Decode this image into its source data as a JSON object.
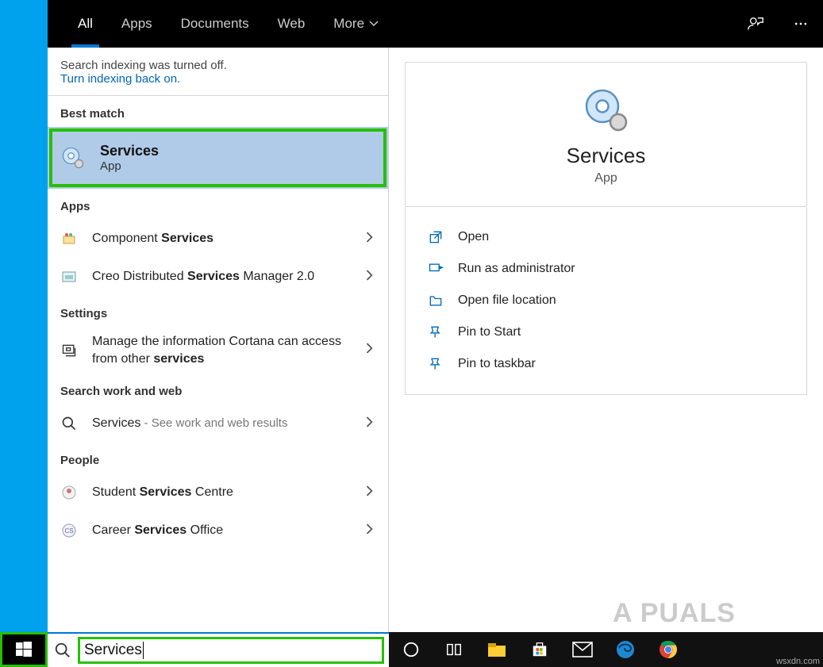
{
  "tabs": {
    "all": "All",
    "apps": "Apps",
    "documents": "Documents",
    "web": "Web",
    "more": "More"
  },
  "notice": {
    "line1": "Search indexing was turned off.",
    "link": "Turn indexing back on."
  },
  "sections": {
    "best_match": "Best match",
    "apps": "Apps",
    "settings": "Settings",
    "sww": "Search work and web",
    "people": "People"
  },
  "best_match": {
    "title": "Services",
    "subtitle": "App"
  },
  "apps_list": [
    {
      "pre": "Component ",
      "bold": "Services",
      "post": ""
    },
    {
      "pre": "Creo Distributed ",
      "bold": "Services",
      "post": " Manager 2.0"
    }
  ],
  "settings_list": [
    {
      "pre": "Manage the information Cortana can access from other ",
      "bold": "services",
      "post": ""
    }
  ],
  "web_list": [
    {
      "title": "Services",
      "hint": " - See work and web results"
    }
  ],
  "people_list": [
    {
      "pre": "Student ",
      "bold": "Services",
      "post": " Centre"
    },
    {
      "pre": "Career ",
      "bold": "Services",
      "post": " Office"
    }
  ],
  "preview": {
    "title": "Services",
    "subtitle": "App"
  },
  "actions": {
    "open": "Open",
    "run_admin": "Run as administrator",
    "open_loc": "Open file location",
    "pin_start": "Pin to Start",
    "pin_taskbar": "Pin to taskbar"
  },
  "searchbox": {
    "value": "Services"
  },
  "watermark": "wsxdn.com",
  "appuals": "A  PUALS"
}
